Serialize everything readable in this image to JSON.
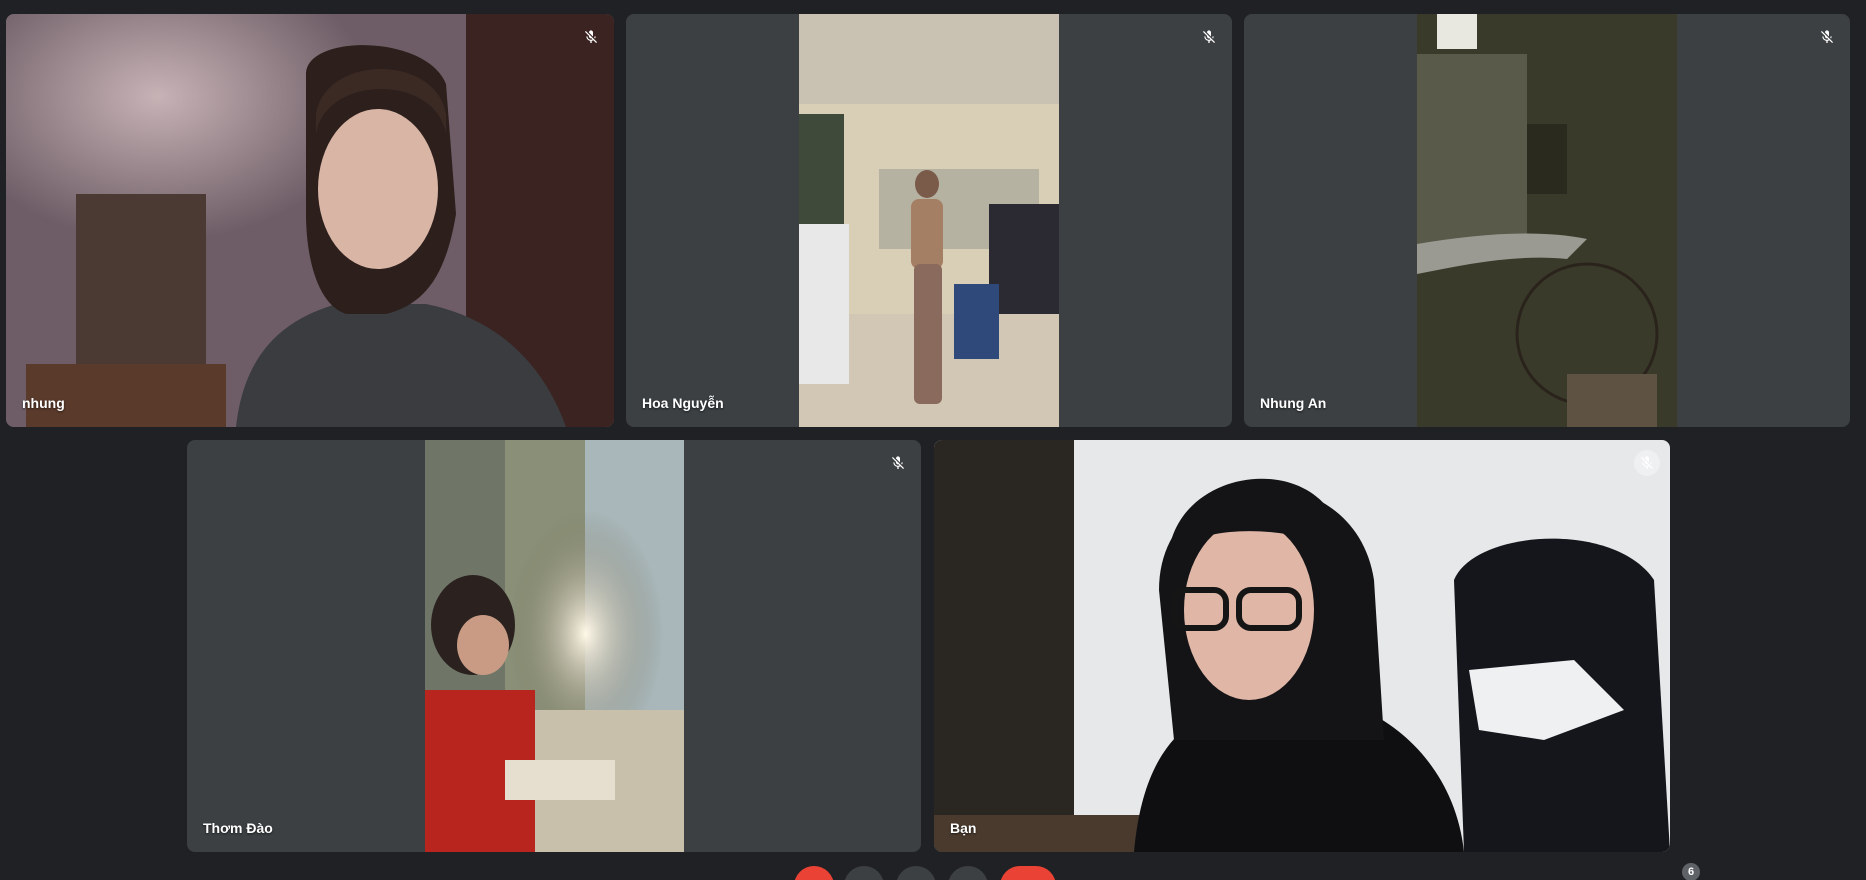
{
  "participants": [
    {
      "name": "nhung",
      "muted": true,
      "video_subject": "woman-at-webcam"
    },
    {
      "name": "Hoa Nguyễn",
      "muted": true,
      "video_subject": "woman-dancing-in-room"
    },
    {
      "name": "Nhung An",
      "muted": true,
      "video_subject": "ceiling-fan-view"
    },
    {
      "name": "Thơm Đào",
      "muted": true,
      "video_subject": "woman-at-desk-lamp"
    },
    {
      "name": "Bạn",
      "muted": true,
      "video_subject": "woman-with-glasses-gaming-chair"
    }
  ],
  "participant_count": "6",
  "icons": {
    "mute": "mic-off-icon",
    "controls": [
      "mic-button",
      "camera-button",
      "captions-button",
      "present-button",
      "leave-call-button"
    ]
  },
  "colors": {
    "background": "#202124",
    "tile": "#3c4043",
    "leave": "#ea4335"
  }
}
